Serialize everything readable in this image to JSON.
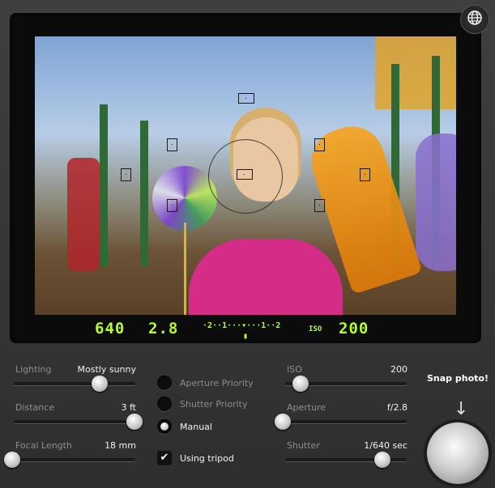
{
  "viewfinder": {
    "lcd_shutter": "640",
    "lcd_aperture": "2.8",
    "meter_scale": "·2··1···▾···1··2",
    "lcd_iso_label": "ISO",
    "lcd_iso_value": "200"
  },
  "controls": {
    "lighting": {
      "label": "Lighting",
      "value": "Mostly sunny",
      "level": 0.74
    },
    "distance": {
      "label": "Distance",
      "value": "3 ft",
      "level": 1.0
    },
    "focal_length": {
      "label": "Focal Length",
      "value": "18 mm",
      "level": 0.0
    },
    "iso": {
      "label": "ISO",
      "value": "200",
      "level": 0.15
    },
    "aperture": {
      "label": "Aperture",
      "value": "f/2.8",
      "level": 0.0
    },
    "shutter": {
      "label": "Shutter",
      "value": "1/640 sec",
      "level": 0.8
    }
  },
  "modes": {
    "items": [
      "Aperture Priority",
      "Shutter Priority",
      "Manual"
    ],
    "selected": "Manual"
  },
  "tripod": {
    "label": "Using tripod",
    "checked": true
  },
  "snap": {
    "label": "Snap photo!",
    "arrow": "↓"
  }
}
